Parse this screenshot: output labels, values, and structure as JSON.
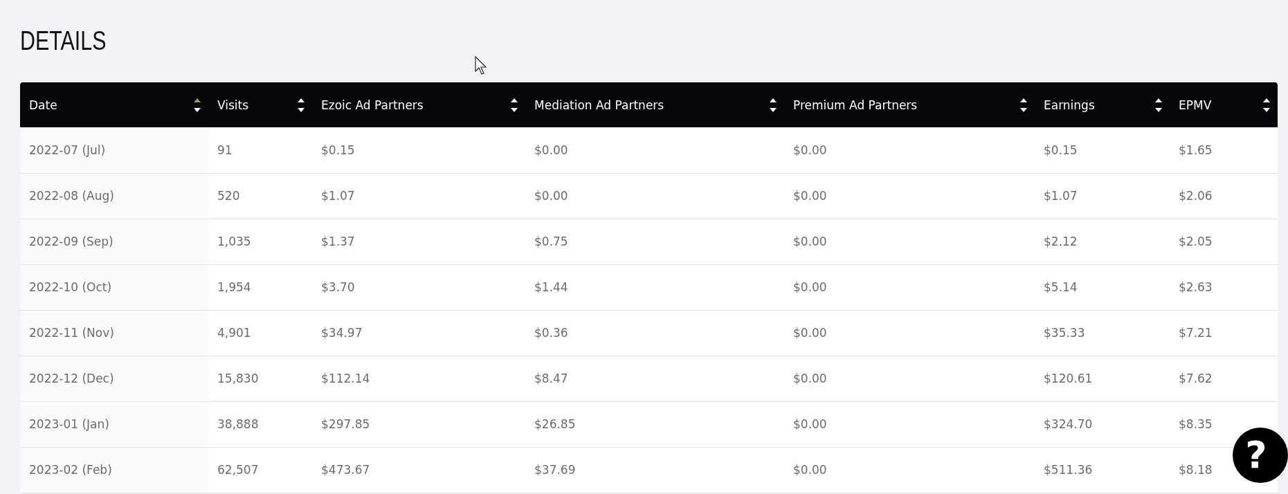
{
  "title": "DETAILS",
  "table": {
    "columns": [
      {
        "label": "Date",
        "sorted": true
      },
      {
        "label": "Visits",
        "sorted": false
      },
      {
        "label": "Ezoic Ad Partners",
        "sorted": false
      },
      {
        "label": "Mediation Ad Partners",
        "sorted": false
      },
      {
        "label": "Premium Ad Partners",
        "sorted": false
      },
      {
        "label": "Earnings",
        "sorted": false
      },
      {
        "label": "EPMV",
        "sorted": false
      }
    ],
    "rows": [
      [
        "2022-07 (Jul)",
        "91",
        "$0.15",
        "$0.00",
        "$0.00",
        "$0.15",
        "$1.65"
      ],
      [
        "2022-08 (Aug)",
        "520",
        "$1.07",
        "$0.00",
        "$0.00",
        "$1.07",
        "$2.06"
      ],
      [
        "2022-09 (Sep)",
        "1,035",
        "$1.37",
        "$0.75",
        "$0.00",
        "$2.12",
        "$2.05"
      ],
      [
        "2022-10 (Oct)",
        "1,954",
        "$3.70",
        "$1.44",
        "$0.00",
        "$5.14",
        "$2.63"
      ],
      [
        "2022-11 (Nov)",
        "4,901",
        "$34.97",
        "$0.36",
        "$0.00",
        "$35.33",
        "$7.21"
      ],
      [
        "2022-12 (Dec)",
        "15,830",
        "$112.14",
        "$8.47",
        "$0.00",
        "$120.61",
        "$7.62"
      ],
      [
        "2023-01 (Jan)",
        "38,888",
        "$297.85",
        "$26.85",
        "$0.00",
        "$324.70",
        "$8.35"
      ],
      [
        "2023-02 (Feb)",
        "62,507",
        "$473.67",
        "$37.69",
        "$0.00",
        "$511.36",
        "$8.18"
      ]
    ]
  },
  "help_button": {
    "label": "?"
  }
}
